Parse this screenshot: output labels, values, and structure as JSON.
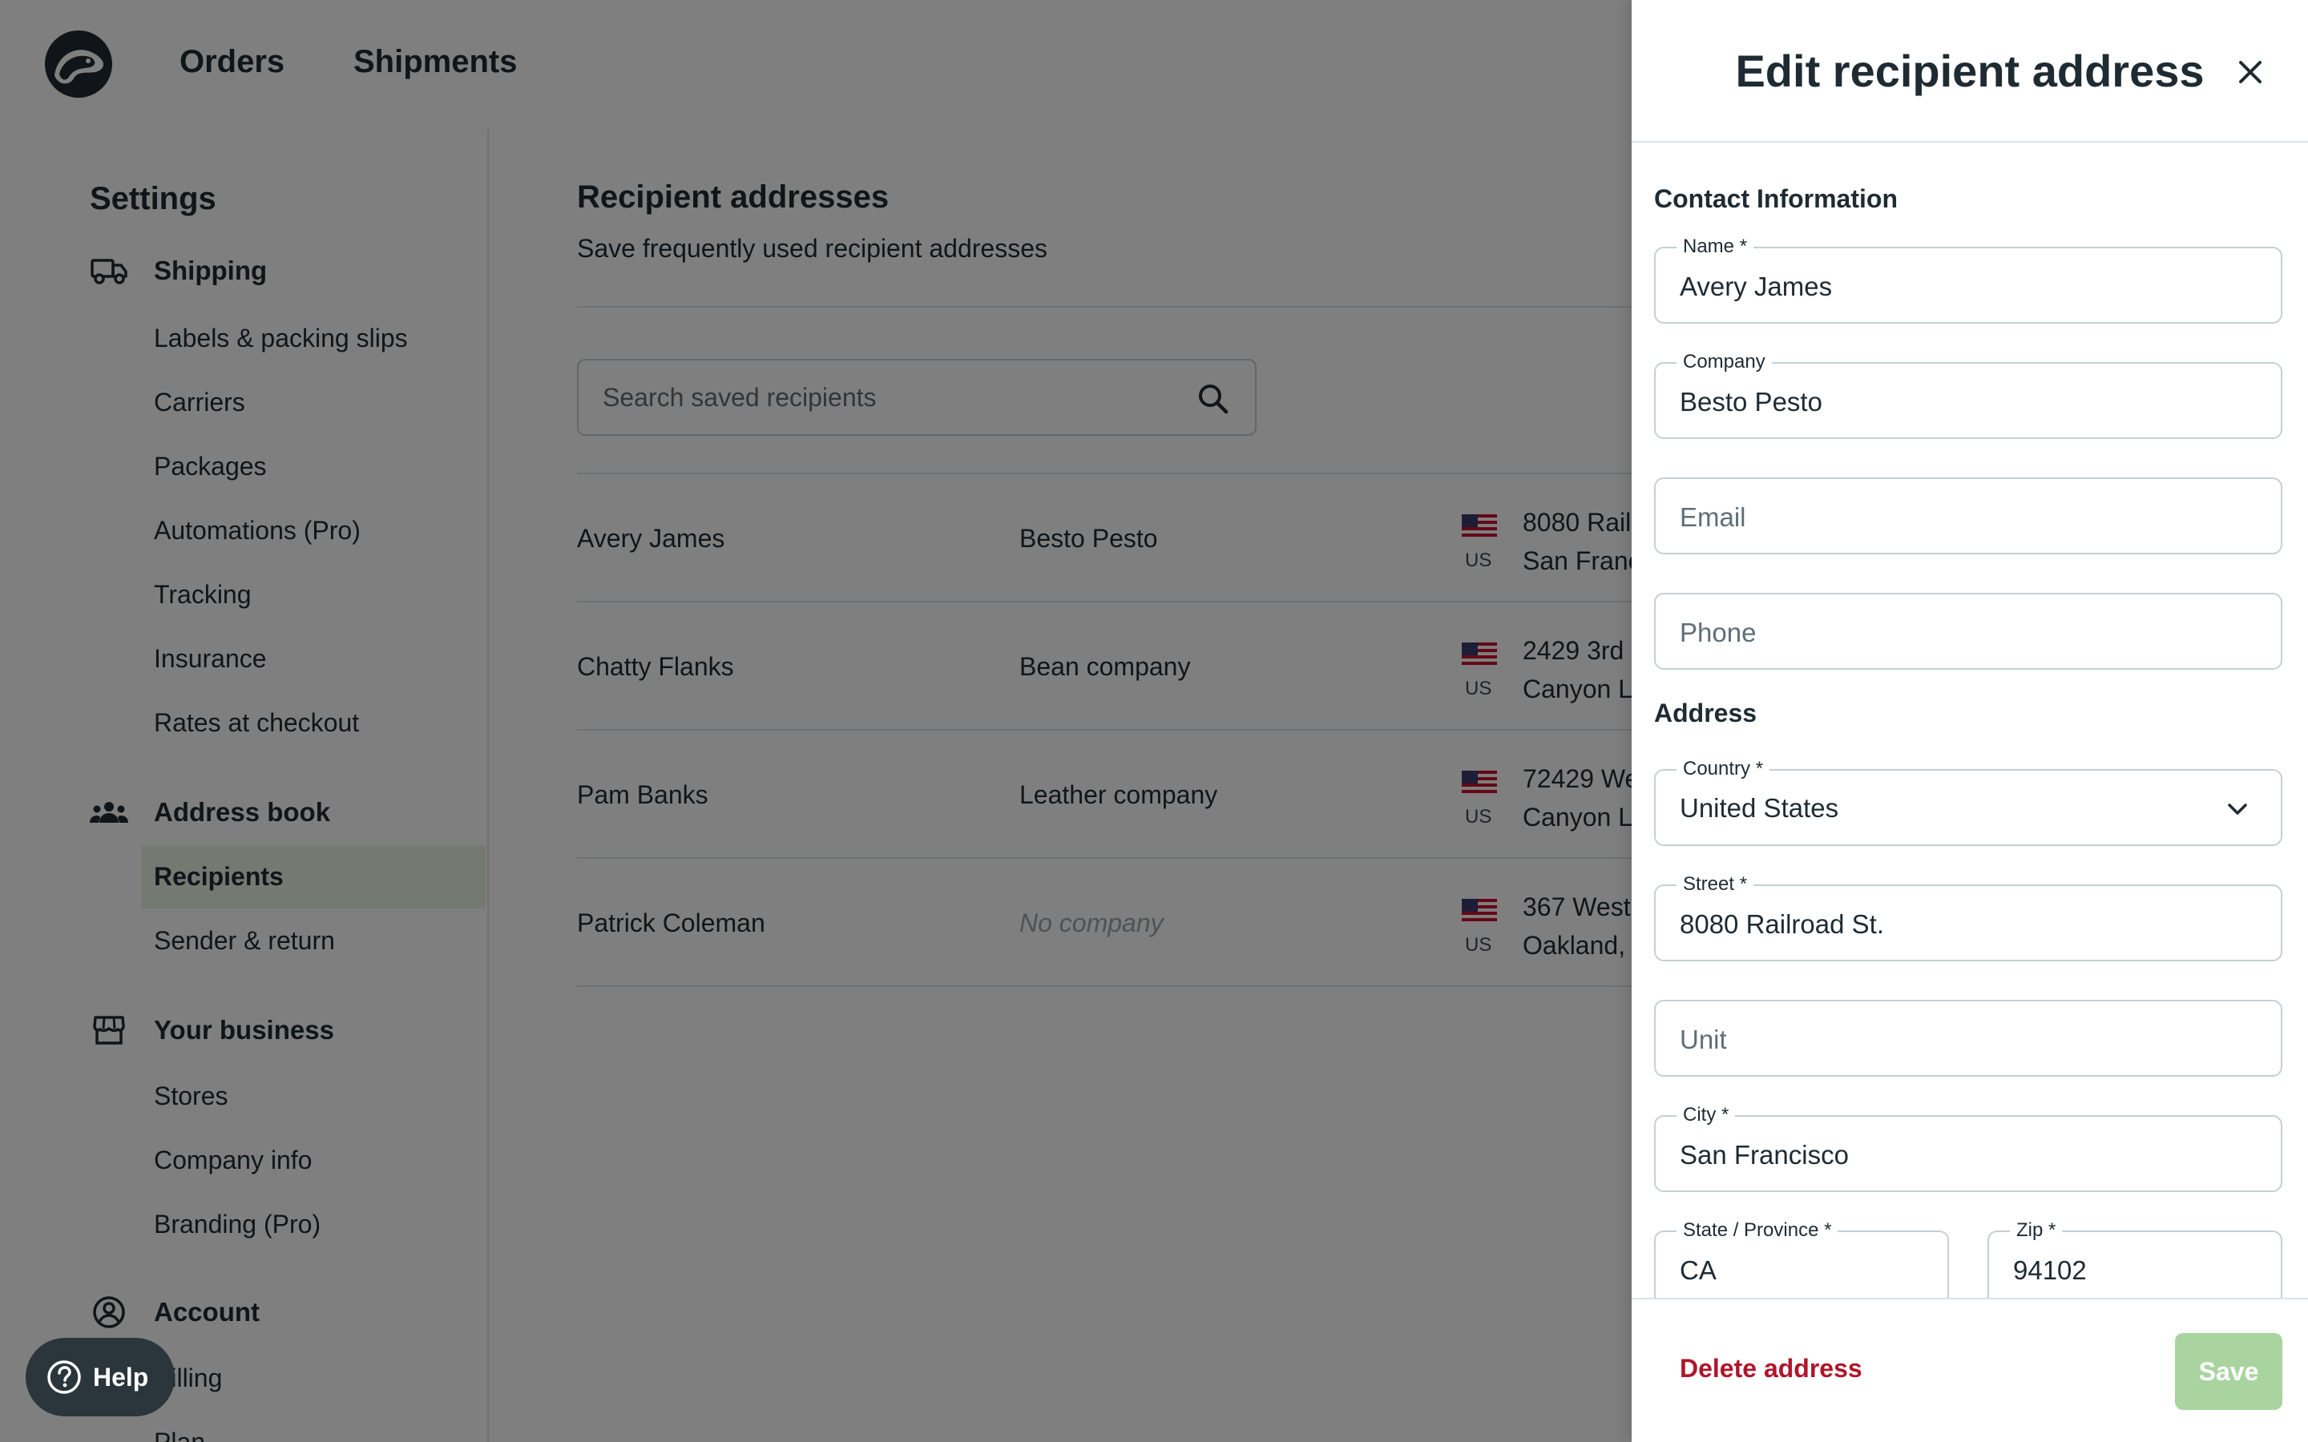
{
  "nav": {
    "orders": "Orders",
    "shipments": "Shipments"
  },
  "sidebar": {
    "title": "Settings",
    "sections": {
      "shipping": "Shipping",
      "address_book": "Address book",
      "your_business": "Your business",
      "account": "Account"
    },
    "shipping_items": [
      "Labels & packing slips",
      "Carriers",
      "Packages",
      "Automations (Pro)",
      "Tracking",
      "Insurance",
      "Rates at checkout"
    ],
    "address_book_items": [
      "Recipients",
      "Sender & return"
    ],
    "business_items": [
      "Stores",
      "Company info",
      "Branding (Pro)"
    ],
    "account_items": [
      "Billing",
      "Plan"
    ]
  },
  "main": {
    "title": "Recipient addresses",
    "subtitle": "Save frequently used recipient addresses",
    "search_placeholder": "Search saved recipients",
    "rows": [
      {
        "name": "Avery James",
        "company": "Besto Pesto",
        "country": "US",
        "line1": "8080 Rail",
        "line2": "San Franc"
      },
      {
        "name": "Chatty Flanks",
        "company": "Bean company",
        "country": "US",
        "line1": "2429 3rd",
        "line2": "Canyon L"
      },
      {
        "name": "Pam Banks",
        "company": "Leather company",
        "country": "US",
        "line1": "72429 We",
        "line2": "Canyon L"
      },
      {
        "name": "Patrick Coleman",
        "company": "No company",
        "country": "US",
        "line1": "367 West",
        "line2": "Oakland, "
      }
    ]
  },
  "help": {
    "label": "Help"
  },
  "drawer": {
    "title": "Edit recipient address",
    "contact_section": "Contact Information",
    "address_section": "Address",
    "fields": {
      "name": {
        "label": "Name *",
        "value": "Avery James"
      },
      "company": {
        "label": "Company",
        "value": "Besto Pesto"
      },
      "email": {
        "placeholder": "Email"
      },
      "phone": {
        "placeholder": "Phone"
      },
      "country": {
        "label": "Country *",
        "value": "United States"
      },
      "street": {
        "label": "Street *",
        "value": "8080 Railroad St."
      },
      "unit": {
        "placeholder": "Unit"
      },
      "city": {
        "label": "City *",
        "value": "San Francisco"
      },
      "state": {
        "label": "State / Province *",
        "value": "CA"
      },
      "zip": {
        "label": "Zip *",
        "value": "94102"
      }
    },
    "delete_label": "Delete address",
    "save_label": "Save"
  },
  "colors": {
    "overlay": "#000000",
    "active_item_bg": "#e8f3e4",
    "delete": "#b0152a",
    "save_bg": "#a9d4a0",
    "text": "#1f2b33"
  },
  "icons": [
    "logo-icon",
    "truck-icon",
    "people-icon",
    "store-icon",
    "account-icon",
    "search-icon",
    "us-flag-icon",
    "help-icon",
    "close-icon",
    "chevron-down-icon"
  ]
}
